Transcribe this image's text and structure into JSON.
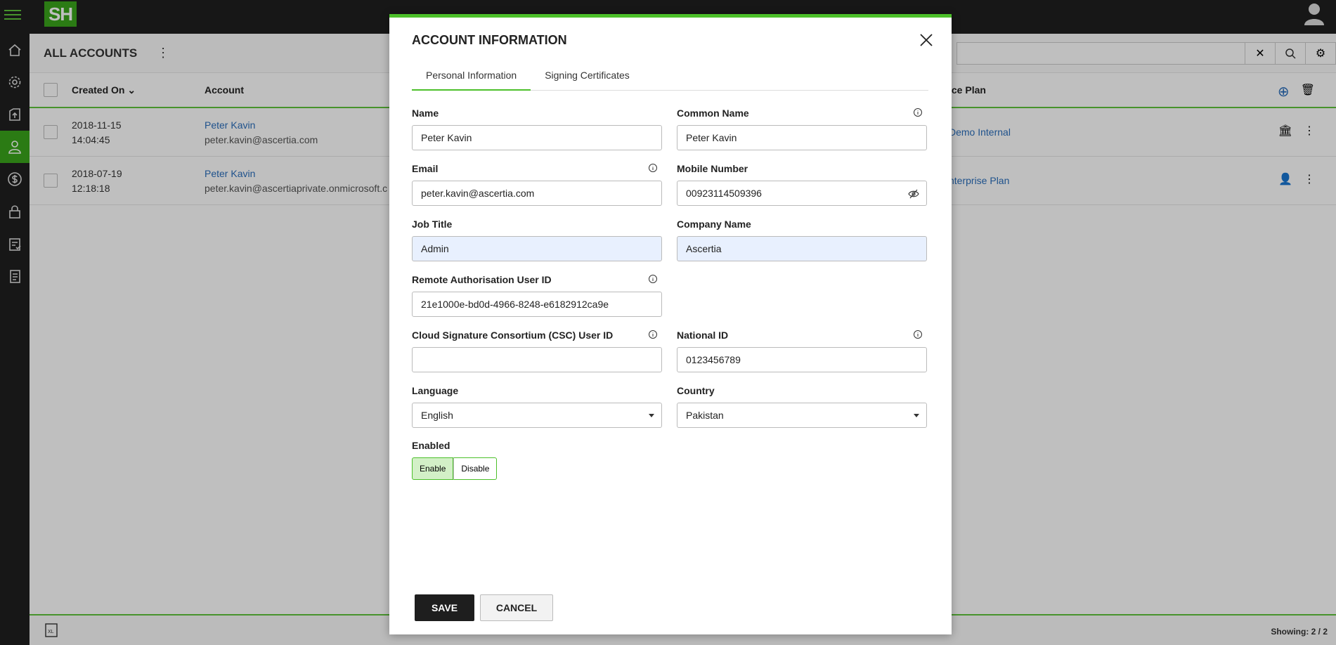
{
  "app": {
    "logo_text": "SH"
  },
  "sidebar": {
    "items": [
      {
        "icon": "home-icon"
      },
      {
        "icon": "gear-icon"
      },
      {
        "icon": "upload-icon"
      },
      {
        "icon": "user-accounts-icon",
        "active": true
      },
      {
        "icon": "dollar-icon"
      },
      {
        "icon": "lock-icon"
      },
      {
        "icon": "clipboard-check-icon"
      },
      {
        "icon": "documents-icon"
      }
    ]
  },
  "page": {
    "title": "ALL ACCOUNTS",
    "columns": {
      "created_on": "Created On",
      "account": "Account",
      "plan": "ice Plan"
    },
    "rows": [
      {
        "date": "2018-11-15",
        "time": "14:04:45",
        "name": "Peter Kavin",
        "email": "peter.kavin@ascertia.com",
        "plan": "Demo Internal"
      },
      {
        "date": "2018-07-19",
        "time": "12:18:18",
        "name": "Peter Kavin",
        "email": "peter.kavin@ascertiaprivate.onmicrosoft.c",
        "plan": "nterprise Plan"
      }
    ],
    "showing": "Showing: 2 / 2"
  },
  "modal": {
    "title": "ACCOUNT INFORMATION",
    "tabs": [
      {
        "label": "Personal Information",
        "active": true
      },
      {
        "label": "Signing Certificates"
      }
    ],
    "fields": {
      "name": {
        "label": "Name",
        "value": "Peter Kavin"
      },
      "common_name": {
        "label": "Common Name",
        "value": "Peter Kavin"
      },
      "email": {
        "label": "Email",
        "value": "peter.kavin@ascertia.com"
      },
      "mobile": {
        "label": "Mobile Number",
        "value": "00923114509396"
      },
      "job_title": {
        "label": "Job Title",
        "value": "Admin"
      },
      "company": {
        "label": "Company Name",
        "value": "Ascertia"
      },
      "remote_auth": {
        "label": "Remote Authorisation User ID",
        "value": "21e1000e-bd0d-4966-8248-e6182912ca9e"
      },
      "csc": {
        "label": "Cloud Signature Consortium (CSC) User ID",
        "value": ""
      },
      "national_id": {
        "label": "National ID",
        "value": "0123456789"
      },
      "language": {
        "label": "Language",
        "value": "English"
      },
      "country": {
        "label": "Country",
        "value": "Pakistan"
      },
      "enabled": {
        "label": "Enabled",
        "on_label": "Enable",
        "off_label": "Disable",
        "state": "Enable"
      }
    },
    "save_label": "SAVE",
    "cancel_label": "CANCEL"
  }
}
